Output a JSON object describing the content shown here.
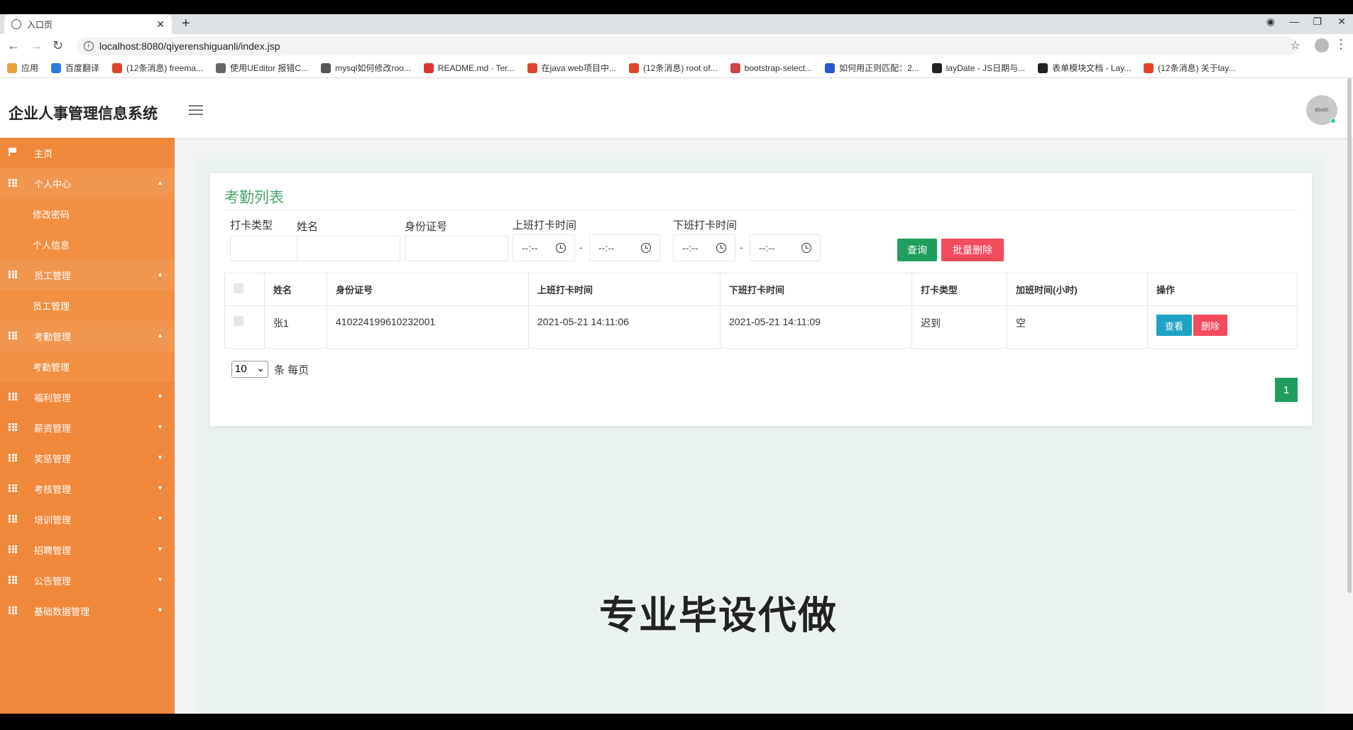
{
  "browser": {
    "tab_title": "入口页",
    "url": "localhost:8080/qiyerenshiguanli/index.jsp",
    "bookmarks": [
      "应用",
      "百度翻译",
      "(12条消息) freema...",
      "使用UEditor 报错C...",
      "mysql如何修改roo...",
      "README.md · Ter...",
      "在java web项目中...",
      "(12条消息) root of...",
      "bootstrap-select...",
      "如何用正则匹配：2...",
      "layDate - JS日期与...",
      "表单模块文档 - Lay...",
      "(12条消息) 关于lay..."
    ]
  },
  "header": {
    "title": "企业人事管理信息系统",
    "avatar_text": "80x80"
  },
  "sidebar": {
    "home": "主页",
    "groups": [
      {
        "label": "个人中心",
        "open": true,
        "children": [
          "修改密码",
          "个人信息"
        ]
      },
      {
        "label": "员工管理",
        "open": true,
        "children": [
          "员工管理"
        ]
      },
      {
        "label": "考勤管理",
        "open": true,
        "children": [
          "考勤管理"
        ]
      },
      {
        "label": "福利管理",
        "open": false,
        "children": []
      },
      {
        "label": "薪资管理",
        "open": false,
        "children": []
      },
      {
        "label": "奖惩管理",
        "open": false,
        "children": []
      },
      {
        "label": "考核管理",
        "open": false,
        "children": []
      },
      {
        "label": "培训管理",
        "open": false,
        "children": []
      },
      {
        "label": "招聘管理",
        "open": false,
        "children": []
      },
      {
        "label": "公告管理",
        "open": false,
        "children": []
      },
      {
        "label": "基础数据管理",
        "open": false,
        "children": []
      }
    ]
  },
  "page": {
    "title": "考勤列表",
    "filters": {
      "type_label": "打卡类型",
      "name_label": "姓名",
      "id_label": "身份证号",
      "on_label": "上班打卡时间",
      "off_label": "下班打卡时间",
      "time_placeholder": "--:--",
      "separator": "-"
    },
    "buttons": {
      "query": "查询",
      "batch_delete": "批量删除",
      "view": "查看",
      "delete": "删除"
    },
    "table": {
      "columns": [
        "姓名",
        "身份证号",
        "上班打卡时间",
        "下班打卡时间",
        "打卡类型",
        "加班时间(小时)",
        "操作"
      ],
      "rows": [
        {
          "name": "张1",
          "id_number": "410224199610232001",
          "on_time": "2021-05-21 14:11:06",
          "off_time": "2021-05-21 14:11:09",
          "type": "迟到",
          "overtime": "空"
        }
      ]
    },
    "pagination": {
      "page_size": "10",
      "page_size_suffix": "条 每页",
      "current_page": "1"
    }
  },
  "overlay_caption": "专业毕设代做",
  "colors": {
    "sidebar": "#f0883b",
    "primary": "#1f9d5d",
    "danger": "#f34a5c",
    "info": "#1ea3c4",
    "title": "#4aa56f"
  }
}
